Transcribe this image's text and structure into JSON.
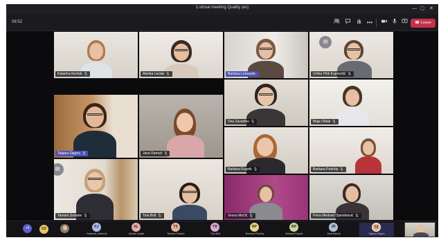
{
  "window": {
    "title": "1.virtual meeting Quality (es)",
    "controls": {
      "minimize": "—",
      "maximize": "▢",
      "close": "✕"
    }
  },
  "toolbar": {
    "timer": "08:52",
    "icons": [
      "people-icon",
      "chat-icon",
      "raise-hand-icon",
      "more-icon",
      "camera-icon",
      "mic-icon",
      "share-icon"
    ],
    "leave_label": "Leave",
    "leave_color": "#c4314b"
  },
  "grid": {
    "participants": [
      {
        "name": "Katarina Ilevčak",
        "mic": "🎙"
      },
      {
        "name": "Alenka Lesiak",
        "mic": "🎙"
      },
      {
        "name": "Barbara Lonzarek",
        "mic": "",
        "highlighted": true
      },
      {
        "name": "Urška Pirik Kuprevšić",
        "mic": "🎙"
      },
      {
        "name": "Tatjana Zagorc",
        "mic": "🎙",
        "highlighted": true
      },
      {
        "name": "Jana Ramuš",
        "mic": "🎙"
      },
      {
        "name": "Dea Zavadlav",
        "mic": "🎙"
      },
      {
        "name": "Maja Oblak",
        "mic": "🎙"
      },
      {
        "name": "Barbara Rupnik",
        "mic": "🎙"
      },
      {
        "name": "Barbara Podržaj",
        "mic": "🎙"
      },
      {
        "name": "Tamara Srdanie",
        "mic": "🎙"
      },
      {
        "name": "Tina Bolt",
        "mic": "🎙"
      },
      {
        "name": "Vesna Močič",
        "mic": "🎙"
      },
      {
        "name": "Petra Medved Opeslinović",
        "mic": "🎙"
      }
    ]
  },
  "strip": {
    "more_label": "+4",
    "chips": [
      {
        "initials": "DZ",
        "name": "",
        "color": "#e8c46a"
      },
      {
        "initials": "KJ",
        "name": "Katarina Jovičević",
        "color": "#a9b7e8"
      },
      {
        "initials": "AL",
        "name": "Alenka Lesjak",
        "color": "#e8a9a9"
      },
      {
        "initials": "TS",
        "name": "Tamara Srdanic",
        "color": "#e8b2a0"
      },
      {
        "initials": "TB",
        "name": "Tina Bolt",
        "color": "#d9a9d0"
      },
      {
        "initials": "BP",
        "name": "Barbara Podržaj",
        "color": "#e8d48a"
      },
      {
        "initials": "BR",
        "name": "Barbara Rupnik",
        "color": "#c8d9a0"
      },
      {
        "initials": "JR",
        "name": "Jana Ramuš",
        "color": "#a9c4e0"
      },
      {
        "initials": "TZ",
        "name": "Tatjana Zagorc",
        "color": "#e8b48a",
        "active": true
      }
    ]
  }
}
